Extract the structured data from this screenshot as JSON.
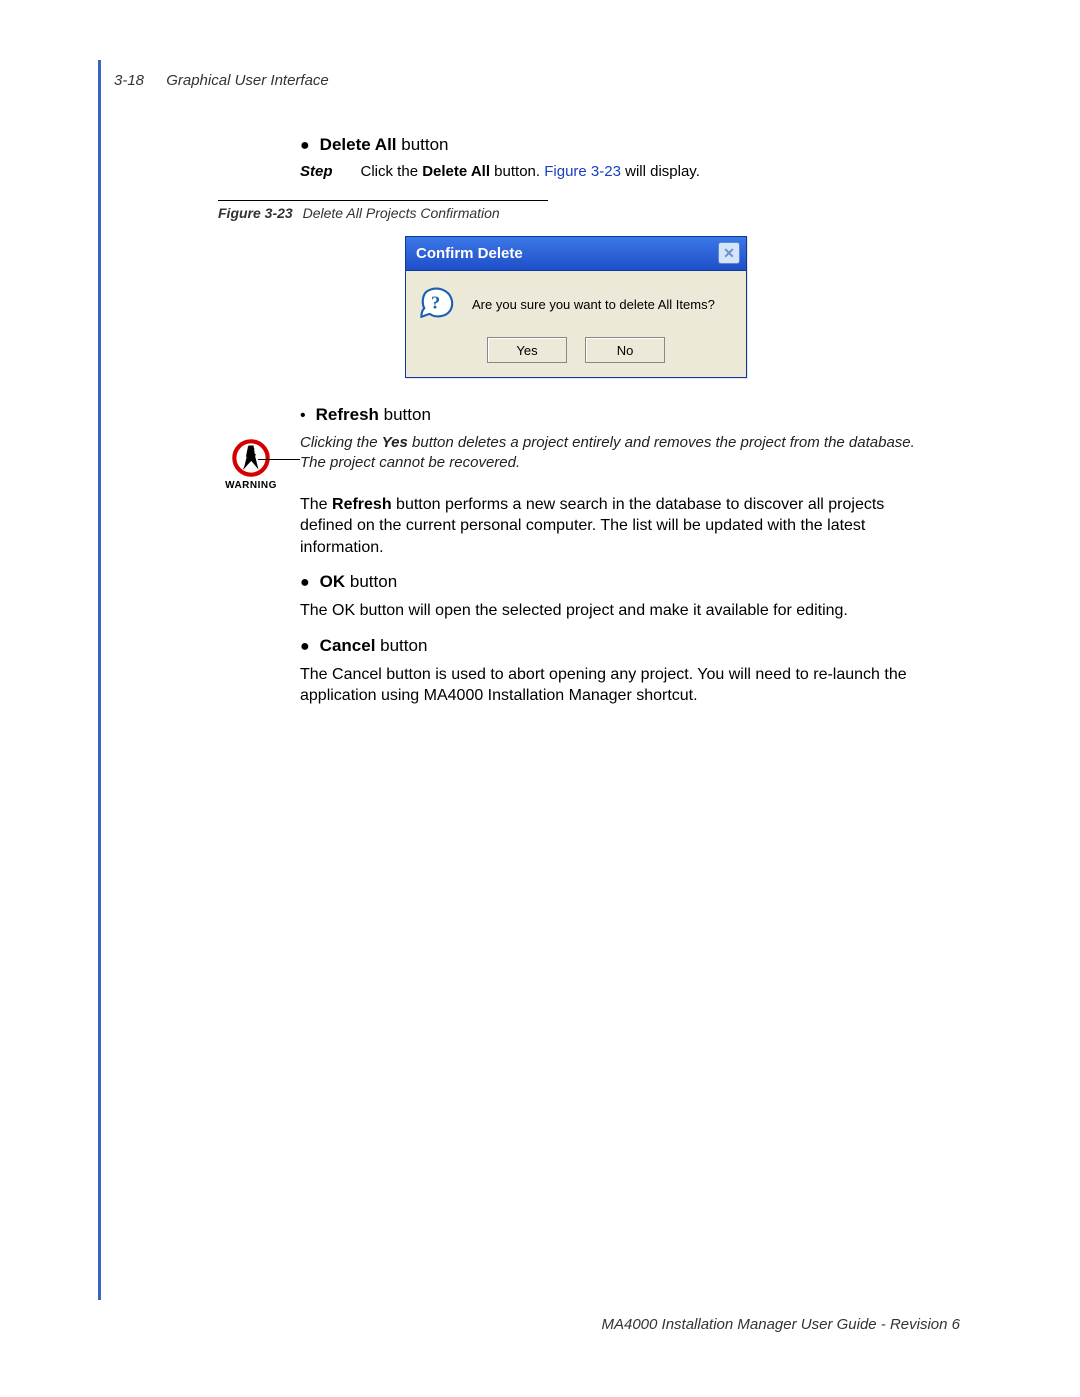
{
  "header": {
    "page_number": "3-18",
    "section_title": "Graphical User Interface"
  },
  "section_delete_all": {
    "bullet_bold": "Delete All",
    "bullet_rest": " button",
    "step_label": "Step",
    "step_text_pre": "Click the ",
    "step_text_bold": "Delete All",
    "step_text_mid": " button. ",
    "step_link": "Figure 3-23",
    "step_text_post": " will display."
  },
  "figure": {
    "number": "Figure 3-23",
    "caption": "Delete All Projects Confirmation"
  },
  "dialog": {
    "title": "Confirm Delete",
    "close_glyph": "✕",
    "message": "Are you sure you want to delete All Items?",
    "yes": "Yes",
    "no": "No"
  },
  "section_refresh": {
    "bullet_bold": "Refresh",
    "bullet_rest": " button"
  },
  "warning": {
    "label": "WARNING",
    "text_pre": "Clicking the ",
    "text_bold": "Yes",
    "text_post": " button deletes a project entirely and removes the project from the database. The project cannot be recovered."
  },
  "refresh_para_pre": "The ",
  "refresh_para_bold": "Refresh",
  "refresh_para_post": " button performs a new search in the database to discover all projects defined on the current personal computer. The list will be updated with the latest information.",
  "section_ok": {
    "bullet_bold": "OK",
    "bullet_rest": " button",
    "para": "The OK button will open the selected project and make it available for editing."
  },
  "section_cancel": {
    "bullet_bold": "Cancel",
    "bullet_rest": " button",
    "para": "The Cancel button is used to abort opening any project. You will need to re-launch the application using MA4000 Installation Manager shortcut."
  },
  "footer": "MA4000 Installation Manager User Guide - Revision 6"
}
